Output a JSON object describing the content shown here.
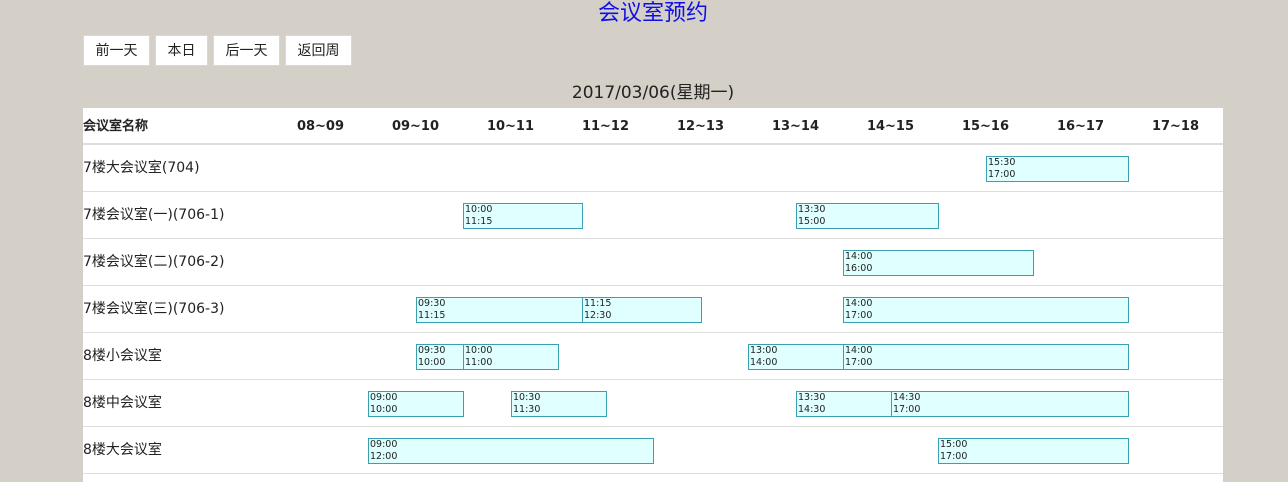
{
  "page_title": "会议室预约",
  "buttons": {
    "prev_day": "前一天",
    "today": "本日",
    "next_day": "后一天",
    "back_week": "返回周"
  },
  "current_date": "2017/03/06(星期一)",
  "table": {
    "name_header": "会议室名称",
    "slots": [
      "08~09",
      "09~10",
      "10~11",
      "11~12",
      "12~13",
      "13~14",
      "14~15",
      "15~16",
      "16~17",
      "17~18"
    ],
    "rooms": [
      {
        "name": "7楼大会议室(704)",
        "bookings": [
          {
            "start": "15:30",
            "end": "17:00"
          }
        ]
      },
      {
        "name": "7楼会议室(一)(706-1)",
        "bookings": [
          {
            "start": "10:00",
            "end": "11:15"
          },
          {
            "start": "13:30",
            "end": "15:00"
          }
        ]
      },
      {
        "name": "7楼会议室(二)(706-2)",
        "bookings": [
          {
            "start": "14:00",
            "end": "16:00"
          }
        ]
      },
      {
        "name": "7楼会议室(三)(706-3)",
        "bookings": [
          {
            "start": "09:30",
            "end": "11:15"
          },
          {
            "start": "11:15",
            "end": "12:30"
          },
          {
            "start": "14:00",
            "end": "17:00"
          }
        ]
      },
      {
        "name": "8楼小会议室",
        "bookings": [
          {
            "start": "09:30",
            "end": "10:00"
          },
          {
            "start": "10:00",
            "end": "11:00"
          },
          {
            "start": "13:00",
            "end": "14:00"
          },
          {
            "start": "14:00",
            "end": "17:00"
          }
        ]
      },
      {
        "name": "8楼中会议室",
        "bookings": [
          {
            "start": "09:00",
            "end": "10:00"
          },
          {
            "start": "10:30",
            "end": "11:30"
          },
          {
            "start": "13:30",
            "end": "14:30"
          },
          {
            "start": "14:30",
            "end": "17:00"
          }
        ]
      },
      {
        "name": "8楼大会议室",
        "bookings": [
          {
            "start": "09:00",
            "end": "12:00"
          },
          {
            "start": "15:00",
            "end": "17:00"
          }
        ]
      }
    ]
  }
}
